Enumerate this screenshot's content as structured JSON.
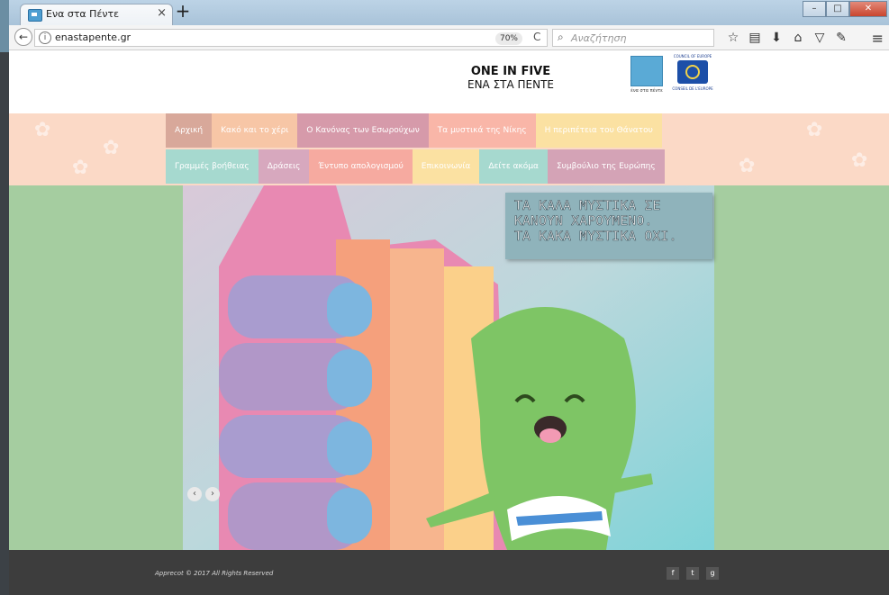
{
  "browser": {
    "tab_title": "Ενα στα Πέντε",
    "tab_close": "×",
    "new_tab": "+",
    "address": "enastapente.gr",
    "zoom": "70%",
    "search_placeholder": "Αναζήτηση",
    "window_controls": [
      "–",
      "□",
      "✕"
    ]
  },
  "header": {
    "brand_line1": "ONE IN FIVE",
    "brand_line2": "ΕΝΑ ΣΤΑ ΠΕΝΤΕ",
    "logo1_text": "ένα στα πέντε",
    "logo2_top": "COUNCIL OF EUROPE",
    "logo2_bottom": "CONSEIL DE L'EUROPE"
  },
  "nav": {
    "row1": [
      {
        "label": "Αρχική",
        "color": "#d8a89a"
      },
      {
        "label": "Κακό και το χέρι",
        "color": "#f7c6a6"
      },
      {
        "label": "Ο Κανόνας των Εσωρούχων",
        "color": "#d69aaa"
      },
      {
        "label": "Τα μυστικά της Νίκης",
        "color": "#f9b6a8"
      },
      {
        "label": "Η περιπέτεια του Θάνατου",
        "color": "#fbe1a2"
      }
    ],
    "row2": [
      {
        "label": "Γραμμές βοήθειας",
        "color": "#a6d9cf"
      },
      {
        "label": "Δράσεις",
        "color": "#d7a8be"
      },
      {
        "label": "Έντυπο απολογισμού",
        "color": "#f6aaa0"
      },
      {
        "label": "Επικοινωνία",
        "color": "#fbe1a2"
      },
      {
        "label": "Δείτε ακόμα",
        "color": "#a6d9cf"
      },
      {
        "label": "Συμβούλιο της Ευρώπης",
        "color": "#d4a3b6"
      }
    ]
  },
  "hero": {
    "caption_line1": "ΤΑ ΚΑΛΑ ΜΥΣΤΙΚΑ ΣΕ",
    "caption_line2": "ΚΑΝΟΥΝ ΧΑΡΟΥΜΕΝΟ.",
    "caption_line3": "ΤΑ ΚΑΚΑ ΜΥΣΤΙΚΑ ΟΧΙ.",
    "prev": "‹",
    "next": "›"
  },
  "footer": {
    "copyright": "Apprecot © 2017 All Rights Reserved",
    "social": [
      "f",
      "t",
      "g"
    ]
  },
  "colors": {
    "peach": "#fbd9c6",
    "green": "#a5cda0",
    "footer": "#3d3d3d"
  }
}
